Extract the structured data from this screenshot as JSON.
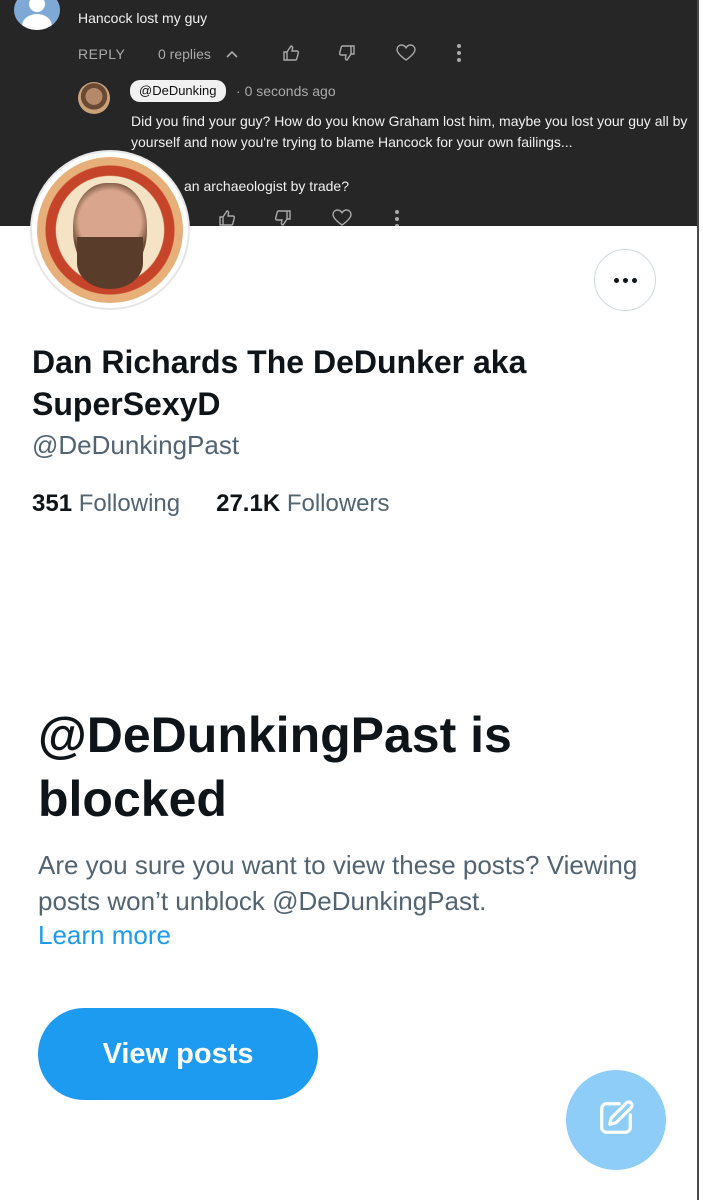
{
  "comment": {
    "text": "Hancock lost my guy",
    "reply_label": "REPLY",
    "replies_count": "0 replies"
  },
  "reply": {
    "handle": "@DeDunking",
    "time": "0 seconds ago",
    "text": "Did you find your guy? How do you know Graham lost him, maybe you lost your guy all by yourself and now you're trying to blame Hancock for your own failings...",
    "text_partial": "an archaeologist by trade?"
  },
  "profile": {
    "name": "Dan Richards The DeDunker aka SuperSexyD",
    "handle": "@DeDunkingPast",
    "following_count": "351",
    "following_label": "Following",
    "followers_count": "27.1K",
    "followers_label": "Followers"
  },
  "blocked": {
    "title": "@DeDunkingPast is blocked",
    "message": "Are you sure you want to view these posts? Viewing posts won’t unblock @DeDunkingPast.",
    "learn_more": "Learn more",
    "view_posts": "View posts"
  },
  "icons": {
    "more": "more-horizontal-icon",
    "compose": "compose-icon",
    "like": "thumbs-up-icon",
    "dislike": "thumbs-down-icon",
    "heart": "heart-icon"
  },
  "colors": {
    "accent": "#1d9bf0",
    "fab": "#8ecdf7",
    "banner_bg": "#262626",
    "secondary_text": "#536471"
  }
}
